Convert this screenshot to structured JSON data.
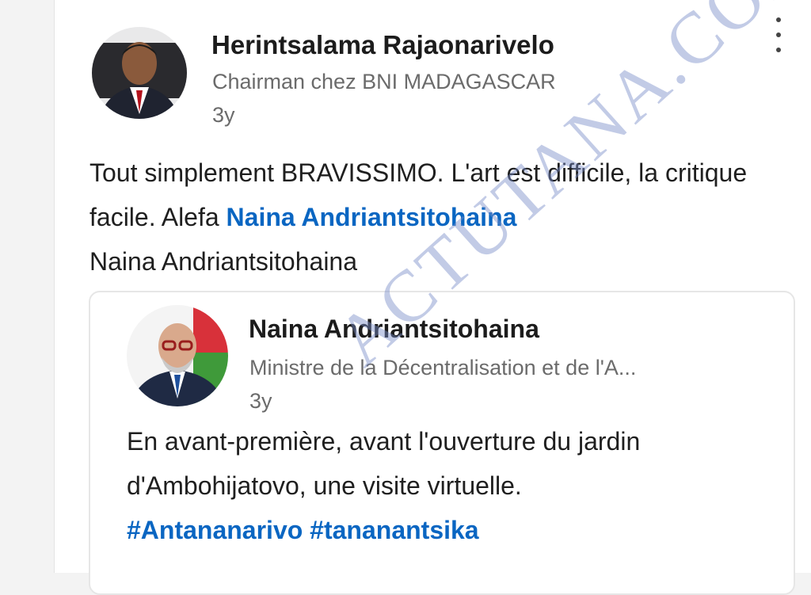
{
  "author": {
    "name": "Herintsalama Rajaonarivelo",
    "headline": "Chairman chez BNI MADAGASCAR",
    "time": "3y"
  },
  "menu_icon": "more-vertical-icon",
  "post": {
    "text_start": "Tout simplement BRAVISSIMO. L'art est difficile, la critique facile. Alefa ",
    "mention": "Naina Andriantsitohaina",
    "text_end": "Naina Andriantsitohaina"
  },
  "shared_post": {
    "author_name": "Naina Andriantsitohaina",
    "headline": "Ministre de la Décentralisation et de l'A...",
    "time": "3y",
    "text": "En avant-première, avant l'ouverture du jardin d'Ambohijatovo, une visite virtuelle.",
    "hashtags": [
      "#Antananarivo",
      "#tananantsika"
    ]
  },
  "watermark": "ACTUTANA.COM",
  "colors": {
    "link": "#0a66c2",
    "watermark": "#788cc8"
  }
}
